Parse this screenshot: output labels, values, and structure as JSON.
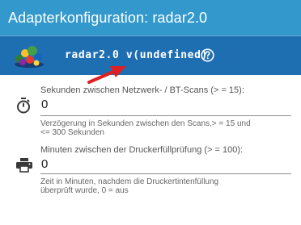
{
  "window": {
    "title": "Adapterkonfiguration: radar2.0"
  },
  "header": {
    "adapter_label": "radar2.0 v(undefined)",
    "logo_icon": "radar2-adapter-logo",
    "help_icon": "help-circle-icon"
  },
  "fields": [
    {
      "icon": "stopwatch-icon",
      "label": "Sekunden zwischen Netzwerk- / BT-Scans (> = 15):",
      "value": "0",
      "helper_line1": "Verzögerung in Sekunden zwischen den Scans,> = 15 und",
      "helper_line2": "<= 300 Sekunden"
    },
    {
      "icon": "printer-icon",
      "label": "Minuten zwischen der Druckerfüllprüfung (> = 100):",
      "value": "0",
      "helper_line1": "Zeit in Minuten, nachdem die Druckertintenfüllung",
      "helper_line2": "überprüft wurde, 0 = aus"
    }
  ],
  "colors": {
    "titlebar": "#3399cc",
    "header": "#1e6fb2",
    "annotation_arrow": "#e02020"
  }
}
